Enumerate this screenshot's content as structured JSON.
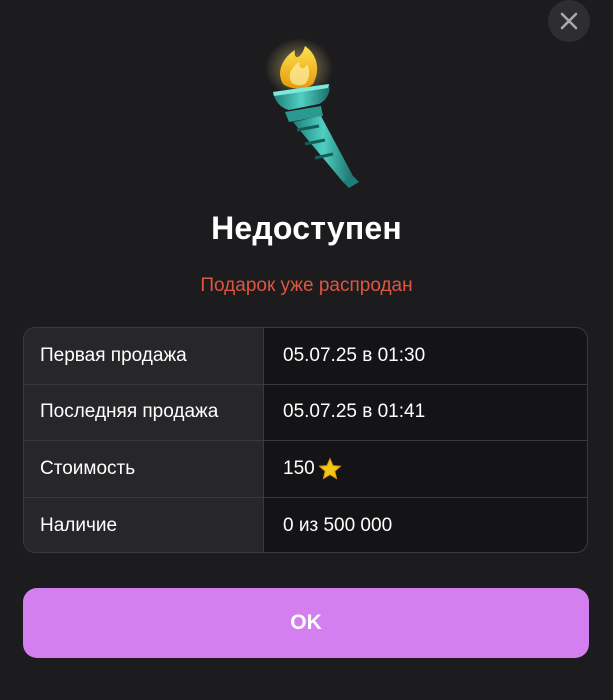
{
  "dialog": {
    "close_icon": "close-icon",
    "illustration": "torch-icon",
    "title": "Недоступен",
    "subtitle": "Подарок уже распродан",
    "info_rows": [
      {
        "label": "Первая продажа",
        "value": "05.07.25 в 01:30"
      },
      {
        "label": "Последняя продажа",
        "value": "05.07.25 в 01:41"
      },
      {
        "label": "Стоимость",
        "value": "150",
        "value_icon": "star-icon"
      },
      {
        "label": "Наличие",
        "value": "0 из 500 000"
      }
    ],
    "ok_label": "OK"
  },
  "colors": {
    "background": "#1c1c1e",
    "subtitle": "#e0553f",
    "button": "#d47ff0",
    "star": "#f5c518"
  }
}
